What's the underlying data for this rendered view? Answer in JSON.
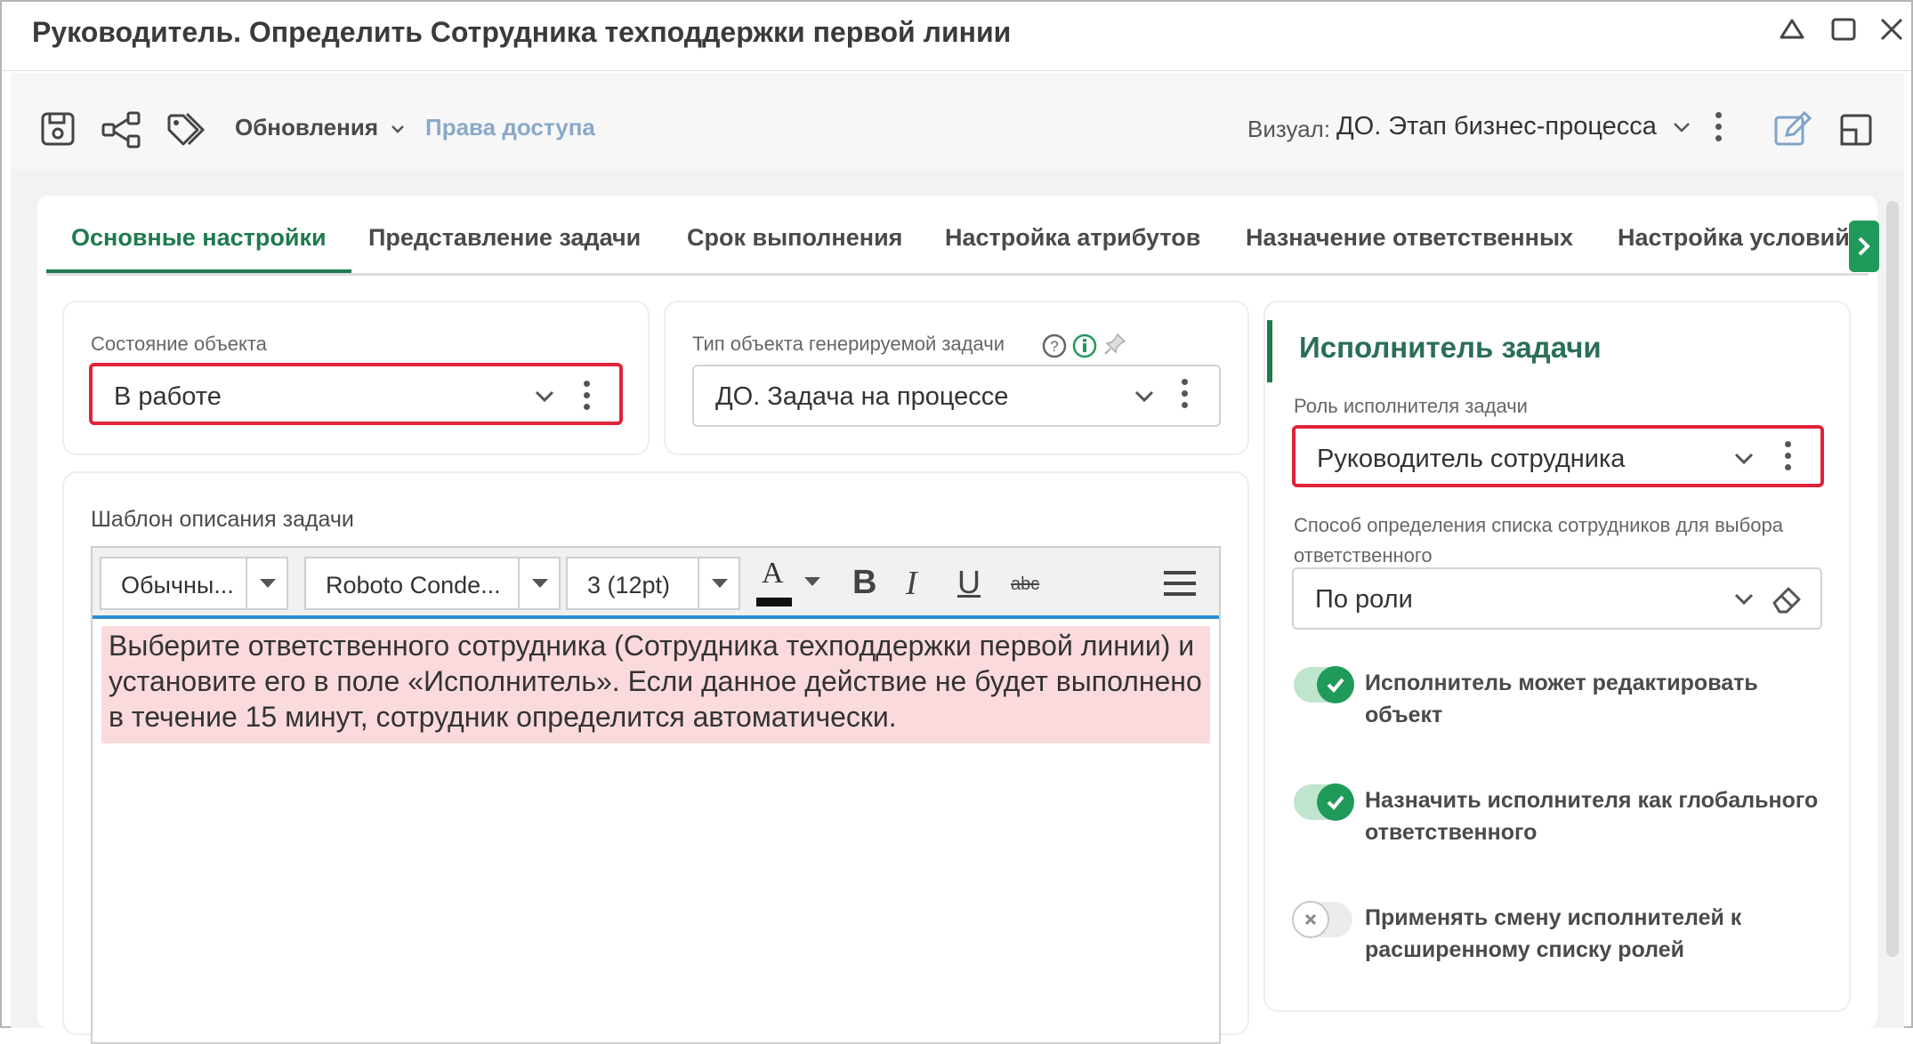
{
  "window": {
    "title": "Руководитель. Определить Сотрудника техподдержки первой линии",
    "controls": [
      "home-icon",
      "maximize-icon",
      "close-icon"
    ]
  },
  "toolbar": {
    "icons": [
      "save-icon",
      "share-icon",
      "tags-icon"
    ],
    "updates_label": "Обновления",
    "access_label": "Права доступа",
    "visual_label": "Визуал:",
    "visual_value": "ДО. Этап бизнес-процесса",
    "right_icons": [
      "edit-icon",
      "layout-icon"
    ]
  },
  "tabs": [
    {
      "label": "Основные настройки",
      "active": true
    },
    {
      "label": "Представление задачи",
      "active": false
    },
    {
      "label": "Срок выполнения",
      "active": false
    },
    {
      "label": "Настройка атрибутов",
      "active": false
    },
    {
      "label": "Назначение ответственных",
      "active": false
    },
    {
      "label": "Настройка условий",
      "active": false
    }
  ],
  "object_state": {
    "label": "Состояние объекта",
    "value": "В работе"
  },
  "task_type": {
    "label": "Тип объекта генерируемой задачи",
    "value": "ДО. Задача на процессе"
  },
  "template": {
    "label": "Шаблон описания задачи",
    "style_value": "Обычны...",
    "font_value": "Roboto Conde...",
    "size_value": "3 (12pt)",
    "color_letter": "A",
    "bold": "B",
    "italic": "I",
    "underline": "U",
    "strike": "abc",
    "text": "Выберите ответственного сотрудника (Сотрудника техподдержки первой линии) и установите его в поле «Исполнитель». Если данное действие не будет выполнено в течение 15 минут, сотрудник определится автоматически."
  },
  "executor": {
    "title": "Исполнитель задачи",
    "role_label": "Роль исполнителя задачи",
    "role_value": "Руководитель сотрудника",
    "method_label": "Способ определения списка сотрудников для выбора ответственного",
    "method_value": "По роли",
    "toggles": [
      {
        "label": "Исполнитель может редактировать объект",
        "on": true
      },
      {
        "label": "Назначить исполнителя как глобального ответственного",
        "on": true
      },
      {
        "label": "Применять смену исполнителей к расширенному списку ролей",
        "on": false
      }
    ]
  },
  "colors": {
    "accent": "#1f7a4d",
    "highlight_border": "#e0233a",
    "text_highlight": "#fadadd",
    "link_muted": "#8aa9c9"
  }
}
